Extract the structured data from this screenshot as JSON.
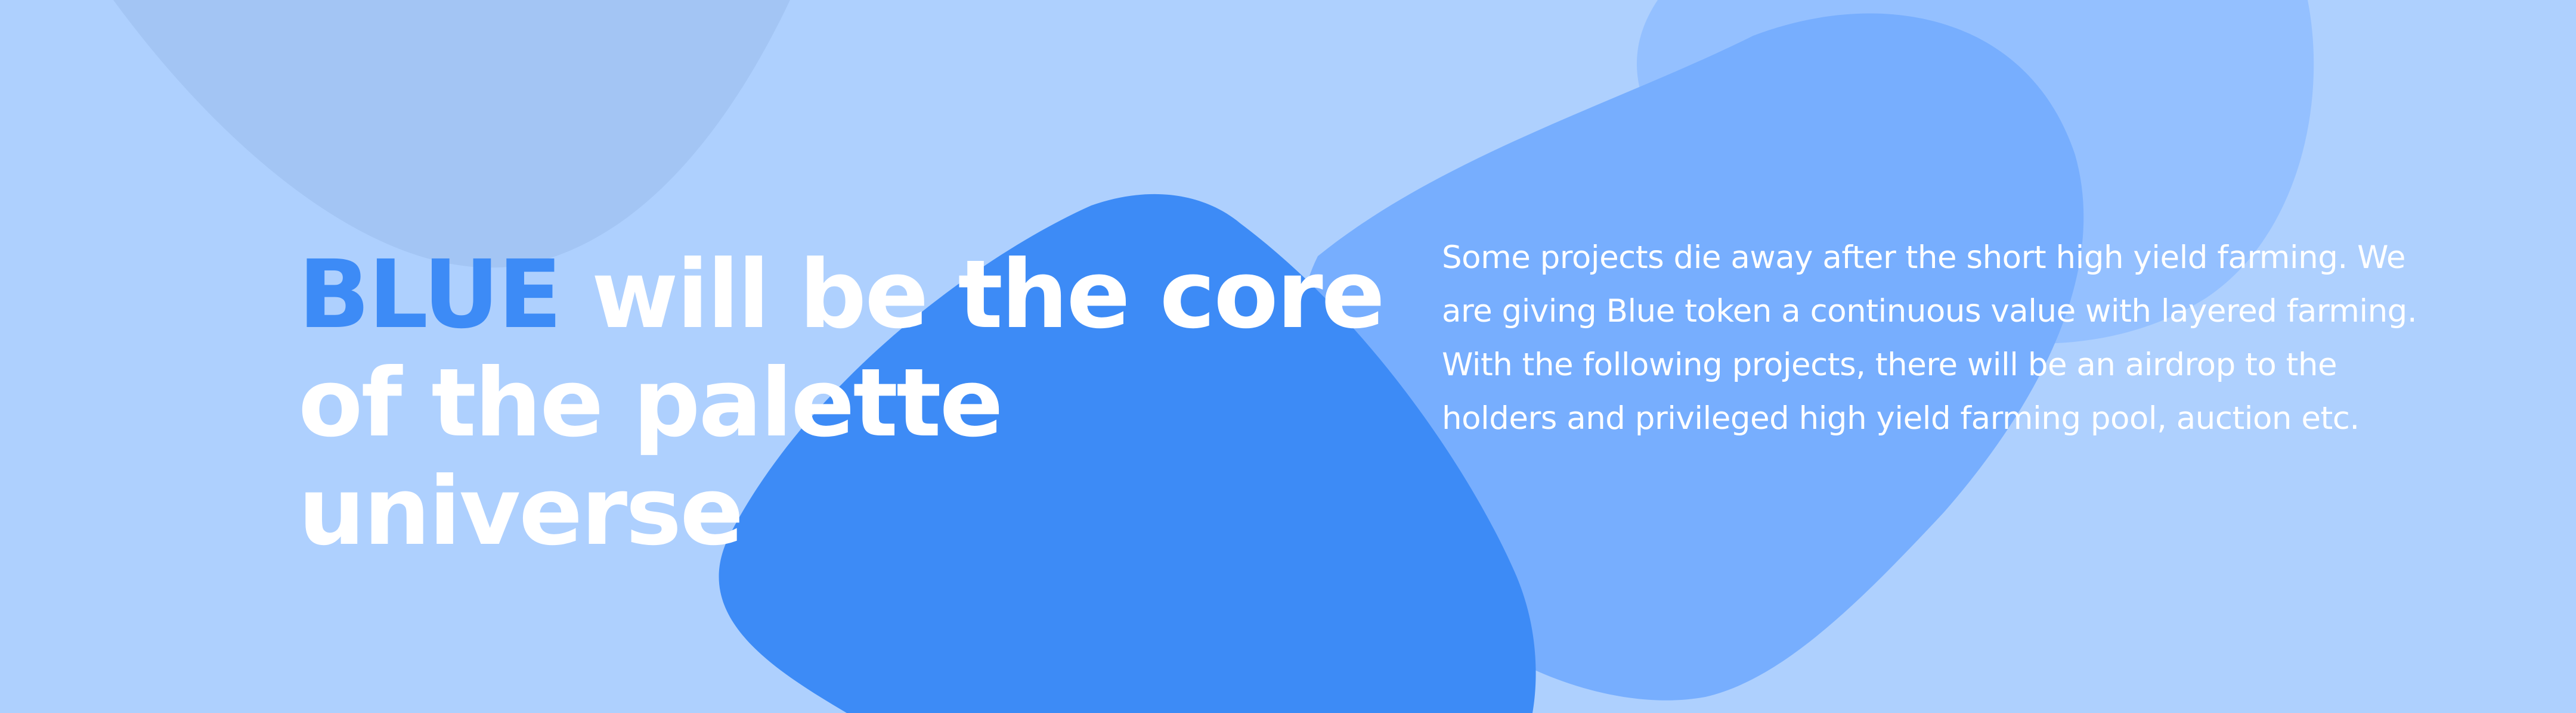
{
  "section": {
    "headline_accent": "BLUE",
    "headline_rest": " will be the core of the palette universe",
    "paragraph": "Some projects die away after the short high yield farming. We are giving Blue token a continuous value with layered farming. With the following projects, there will be an airdrop to the holders and privileged high yield farming pool, auction etc."
  },
  "colors": {
    "background": "#aed0fe",
    "accent": "#3d8bf6",
    "blob_dark": "#3d8bf6",
    "blob_mid": "#77aefe",
    "blob_light": "#94c0ff",
    "blob_muted": "#a3c5f4",
    "text": "#ffffff"
  }
}
